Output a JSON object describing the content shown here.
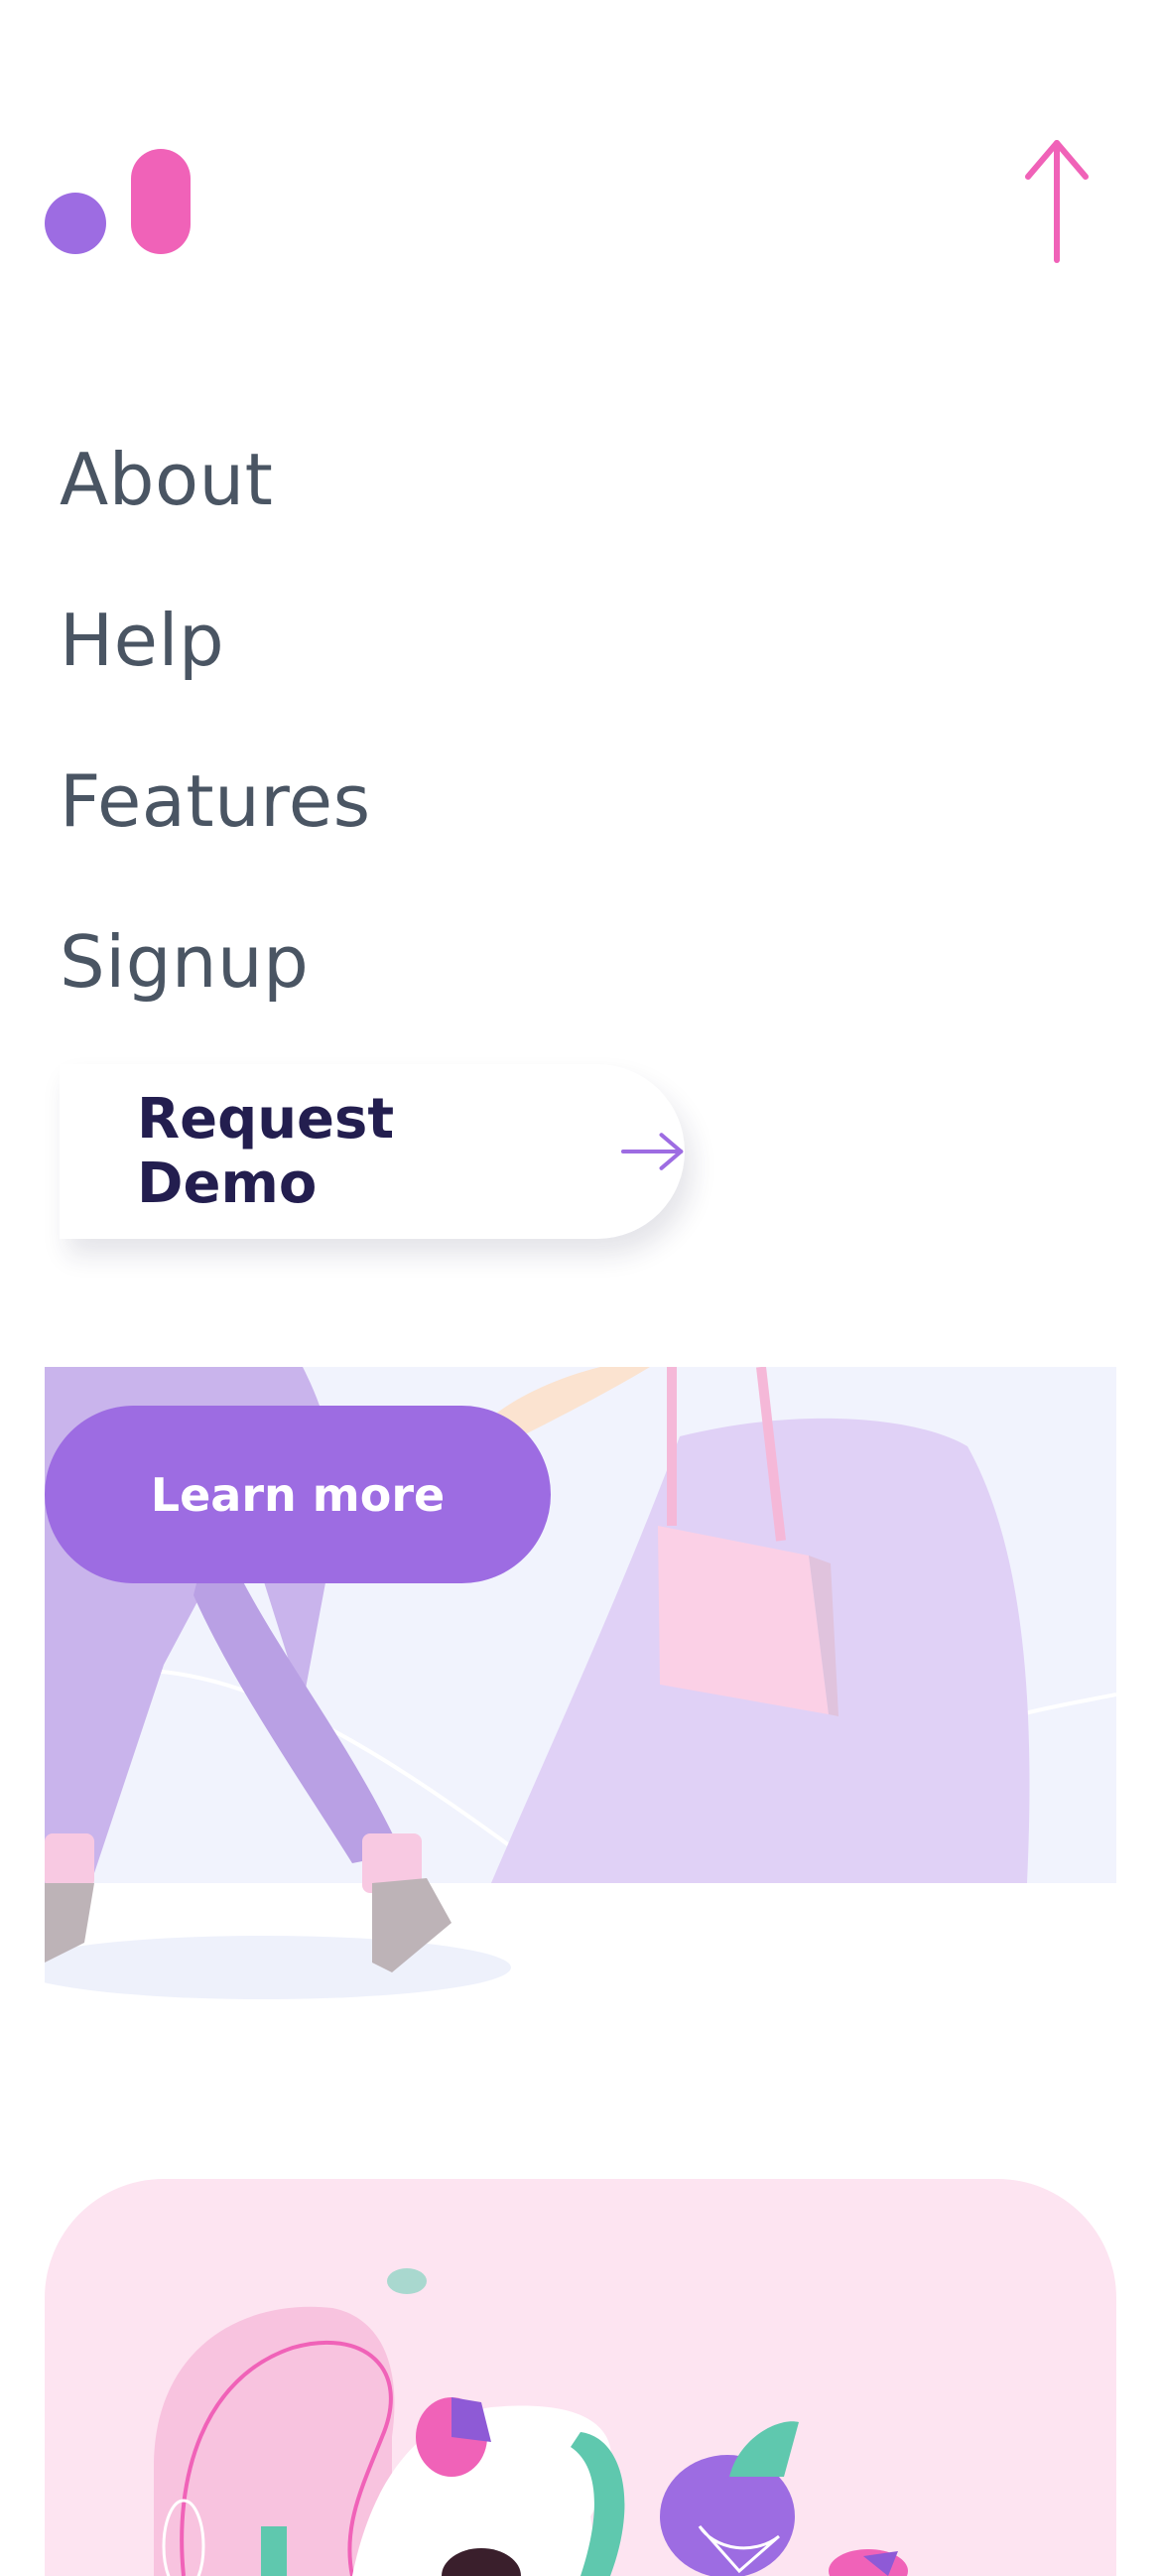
{
  "header": {
    "logo_icon": "brand-logo-icon",
    "scroll_top_icon": "arrow-up-icon"
  },
  "nav": {
    "items": [
      {
        "label": "About"
      },
      {
        "label": "Help"
      },
      {
        "label": "Features"
      },
      {
        "label": "Signup"
      }
    ]
  },
  "demo_button": {
    "label": "Request Demo",
    "icon": "arrow-right-icon"
  },
  "hero": {
    "image": "walking-woman-illustration",
    "button_label": "Learn more"
  },
  "feature_card": {
    "image": "analytics-shapes-illustration"
  },
  "colors": {
    "purple": "#9d6ce2",
    "pink": "#f062b8",
    "nav_text": "#4a5563",
    "dark_navy": "#231e4f",
    "card_pink": "#fde4f1"
  }
}
